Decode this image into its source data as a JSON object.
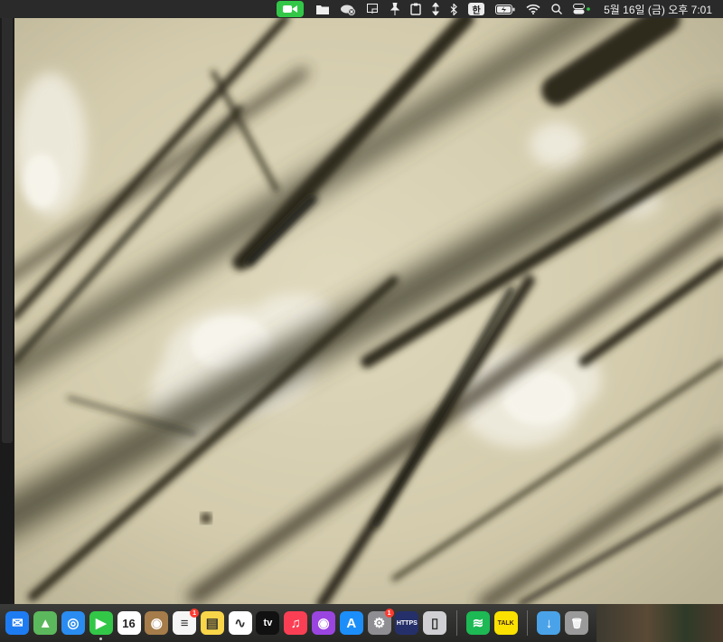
{
  "menubar": {
    "icons": [
      "facetime-icon",
      "folder-icon",
      "cloud-icon",
      "screen-capture-icon",
      "pin-icon",
      "clipboard-icon",
      "arrows-icon",
      "bluetooth-icon",
      "input-source-icon",
      "battery-icon",
      "wifi-icon",
      "spotlight-icon",
      "control-center-icon"
    ],
    "input_source": "한",
    "clock": "5월 16일 (금) 오후 7:01",
    "facetime_color": "#33c748"
  },
  "dock": {
    "apps": [
      {
        "name": "Mail",
        "icon": "mail-icon",
        "color": "#1e7cf2",
        "glyph": "✉"
      },
      {
        "name": "Maps",
        "icon": "maps-icon",
        "color": "#5cb85c",
        "glyph": "▲"
      },
      {
        "name": "Safari",
        "icon": "safari-icon",
        "color": "#2a8cf0",
        "glyph": "◎"
      },
      {
        "name": "FaceTime",
        "icon": "facetime-icon",
        "color": "#33c748",
        "glyph": "▶",
        "running": true
      },
      {
        "name": "Calendar",
        "icon": "calendar-icon",
        "color": "#ffffff",
        "glyph": "16",
        "label": "16"
      },
      {
        "name": "Contacts",
        "icon": "contacts-icon",
        "color": "#a57c4a",
        "glyph": "◉"
      },
      {
        "name": "Reminders",
        "icon": "reminders-icon",
        "color": "#f5f5f5",
        "glyph": "≡",
        "badge": "1"
      },
      {
        "name": "Notes",
        "icon": "notes-icon",
        "color": "#f9d549",
        "glyph": "▤"
      },
      {
        "name": "Freeform",
        "icon": "freeform-icon",
        "color": "#ffffff",
        "glyph": "∿"
      },
      {
        "name": "TV",
        "icon": "apple-tv-icon",
        "color": "#111111",
        "glyph": "tv",
        "label": "tv"
      },
      {
        "name": "Music",
        "icon": "music-icon",
        "color": "#fa3f54",
        "glyph": "♫"
      },
      {
        "name": "Podcasts",
        "icon": "podcasts-icon",
        "color": "#9b45e0",
        "glyph": "◉"
      },
      {
        "name": "App Store",
        "icon": "app-store-icon",
        "color": "#1c8ef9",
        "glyph": "A"
      },
      {
        "name": "System Settings",
        "icon": "settings-icon",
        "color": "#8e8e93",
        "glyph": "⚙",
        "badge": "1"
      },
      {
        "name": "HTTPS",
        "icon": "https-icon",
        "color": "#25306a",
        "glyph": "HTTPS",
        "label": "HTTPS"
      },
      {
        "name": "iPhone Mirroring",
        "icon": "iphone-mirroring-icon",
        "color": "#d0d0d4",
        "glyph": "▯"
      },
      {
        "name": "Spotify",
        "icon": "spotify-icon",
        "color": "#1db954",
        "glyph": "≋"
      },
      {
        "name": "KakaoTalk",
        "icon": "kakaotalk-icon",
        "color": "#fae100",
        "glyph": "TALK",
        "label": "TALK"
      },
      {
        "name": "Downloads",
        "icon": "downloads-folder-icon",
        "color": "#4aa3e8",
        "glyph": "↓"
      },
      {
        "name": "Trash",
        "icon": "trash-icon",
        "color": "#9a9a9a",
        "glyph": "🗑"
      }
    ]
  },
  "photo": {
    "subject": "microscope-photo-of-scalp-hairs",
    "background_color": "#d6cfb4",
    "hair_color": "#2e2a1c"
  }
}
